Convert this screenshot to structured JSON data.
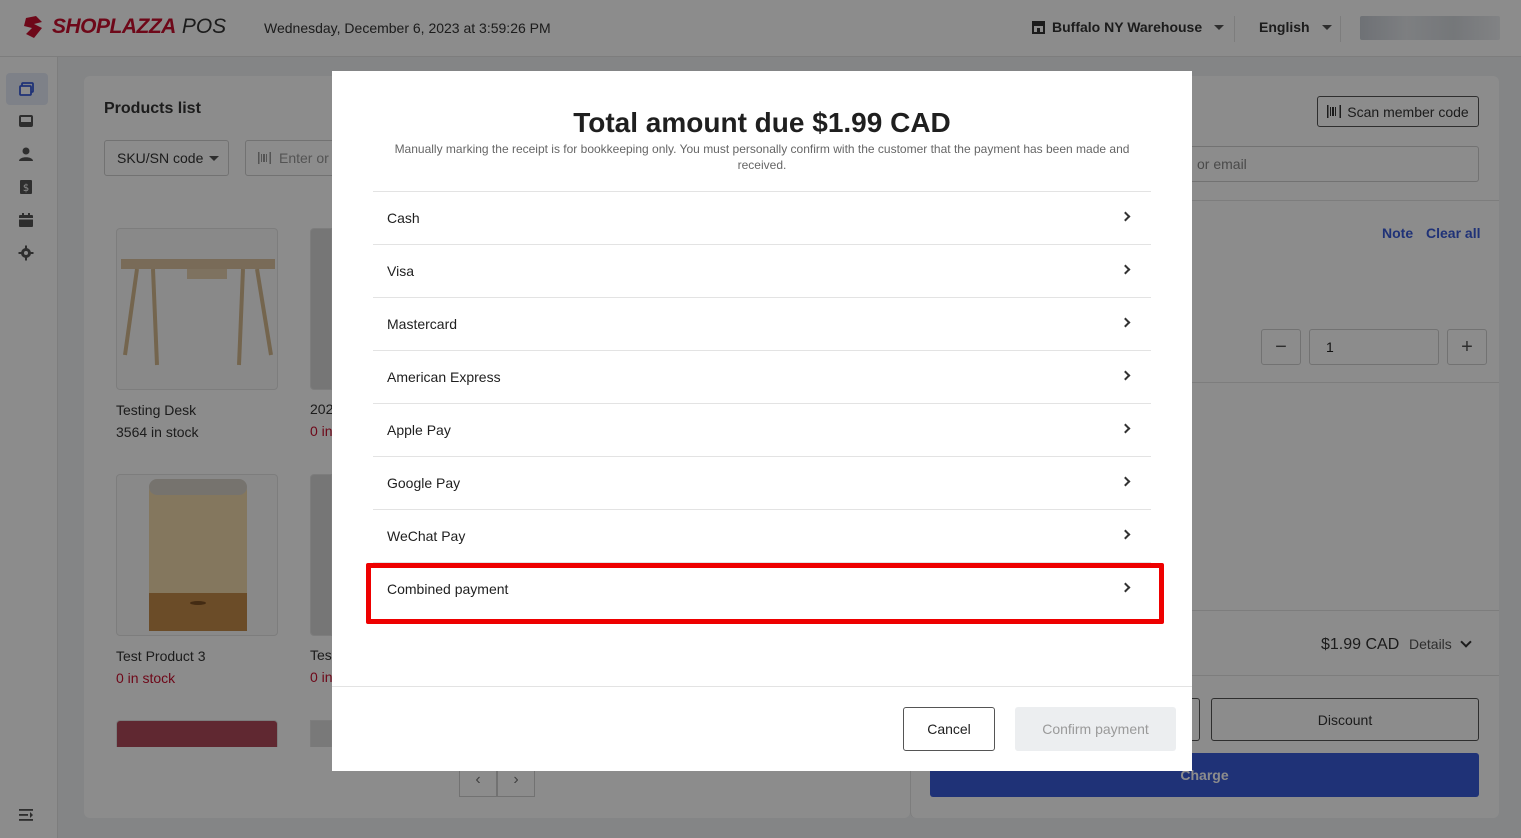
{
  "header": {
    "logo_text": "SHOPLAZZA",
    "logo_suffix": "POS",
    "datetime": "Wednesday, December 6, 2023 at 3:59:26 PM",
    "warehouse": "Buffalo NY Warehouse",
    "language": "English"
  },
  "sidebar": {
    "items": [
      "orders-icon",
      "inbox-icon",
      "customer-icon",
      "payment-icon",
      "calendar-icon",
      "settings-icon"
    ],
    "bottom": "menu-collapse-icon"
  },
  "products": {
    "title": "Products list",
    "filter_select": "SKU/SN code",
    "search_placeholder": "Enter or",
    "items": [
      {
        "name": "Testing Desk",
        "stock": "3564 in stock"
      },
      {
        "name": "Test Product 3",
        "stock": "0 in stock"
      }
    ],
    "partial": [
      {
        "name": "202",
        "stock": "0 in"
      },
      {
        "name": "Test",
        "stock": "0 in"
      }
    ]
  },
  "cart": {
    "scan_label": "Scan member code",
    "email_placeholder": "or email",
    "note": "Note",
    "clear_all": "Clear all",
    "qty": "1",
    "total": "$1.99 CAD",
    "details": "Details",
    "discount": "Discount",
    "charge": "Charge"
  },
  "modal": {
    "title": "Total amount due $1.99 CAD",
    "subtitle": "Manually marking the receipt is for bookkeeping only. You must personally confirm with the customer that the payment has been made and received.",
    "methods": [
      "Cash",
      "Visa",
      "Mastercard",
      "American Express",
      "Apple Pay",
      "Google Pay",
      "WeChat Pay",
      "Combined payment"
    ],
    "cancel": "Cancel",
    "confirm": "Confirm payment"
  },
  "colors": {
    "brand": "#c8102e",
    "accent": "#3a5bd9",
    "highlight": "#ee0000"
  }
}
